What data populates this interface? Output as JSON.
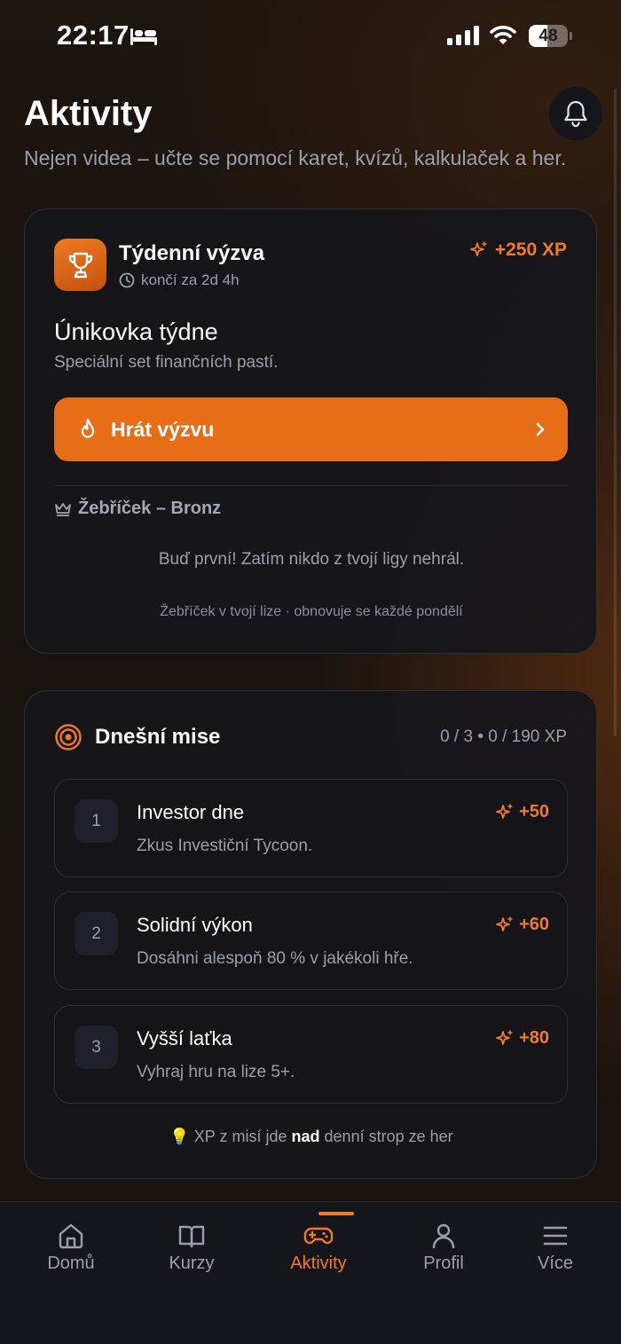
{
  "status_bar": {
    "time": "22:17",
    "battery": "48",
    "battery_level": 0.48
  },
  "header": {
    "title": "Aktivity",
    "subtitle": "Nejen videa – učte se pomocí karet, kvízů, kalkulaček a her."
  },
  "weekly_challenge": {
    "label": "Týdenní výzva",
    "ends_in": "končí za 2d 4h",
    "xp": "+250 XP",
    "name": "Únikovka týdne",
    "description": "Speciální set finančních pastí.",
    "play_label": "Hrát výzvu",
    "leaderboard_title": "Žebříček – Bronz",
    "leaderboard_empty": "Buď první! Zatím nikdo z tvojí ligy nehrál.",
    "leaderboard_note": "Žebříček v tvojí lize · obnovuje se každé pondělí"
  },
  "missions": {
    "title": "Dnešní mise",
    "progress": "0 / 3 • 0 / 190 XP",
    "items": [
      {
        "num": "1",
        "title": "Investor dne",
        "description": "Zkus Investiční Tycoon.",
        "xp": "+50"
      },
      {
        "num": "2",
        "title": "Solidní výkon",
        "description": "Dosáhni alespoň 80 % v jakékoli hře.",
        "xp": "+60"
      },
      {
        "num": "3",
        "title": "Vyšší laťka",
        "description": "Vyhraj hru na lize 5+.",
        "xp": "+80"
      }
    ],
    "tip_before": "XP z misí jde ",
    "tip_bold": "nad",
    "tip_after": " denní strop ze her"
  },
  "tab_bar": {
    "items": [
      {
        "label": "Domů",
        "icon": "home-icon"
      },
      {
        "label": "Kurzy",
        "icon": "book-icon"
      },
      {
        "label": "Aktivity",
        "icon": "gamepad-icon",
        "active": true
      },
      {
        "label": "Profil",
        "icon": "user-icon"
      },
      {
        "label": "Více",
        "icon": "menu-icon"
      }
    ]
  },
  "colors": {
    "accent": "#e76e17",
    "accent_text": "#f07a25",
    "card": "#16161b",
    "muted": "#9aa0ab"
  }
}
